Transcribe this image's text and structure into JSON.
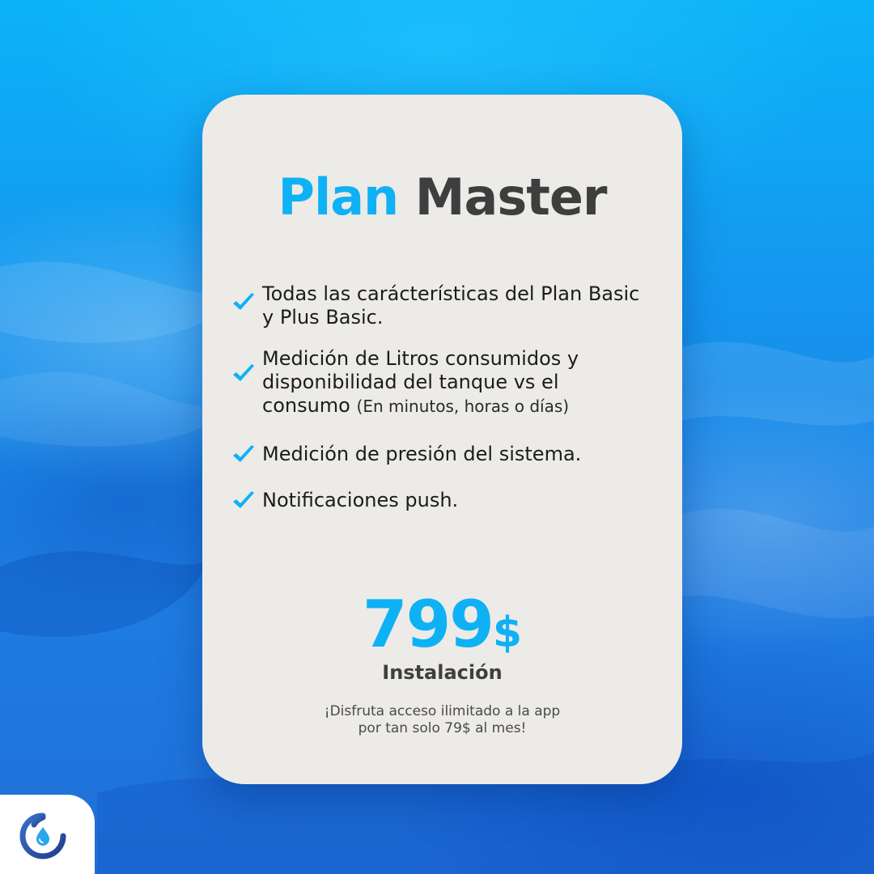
{
  "colors": {
    "accent": "#0fb1f5",
    "dark": "#3e3e3e",
    "check": "#0fb1f5"
  },
  "title": {
    "accent_word": "Plan",
    "dark_word": "Master"
  },
  "features": [
    {
      "text": "Todas las carácterísticas del Plan Basic y Plus Basic.",
      "icon": "check-icon"
    },
    {
      "text": "Medición de Litros consumidos y disponibilidad del tanque vs el consumo",
      "note": "(En minutos, horas o días)",
      "icon": "check-icon"
    },
    {
      "text": "Medición de presión del sistema.",
      "icon": "check-icon"
    },
    {
      "text": "Notificaciones push.",
      "icon": "check-icon"
    }
  ],
  "price": {
    "amount": "799",
    "currency": "$",
    "label": "Instalación"
  },
  "promo": {
    "line1": "¡Disfruta acceso ilimitado a la app",
    "line2": "por tan solo 79$ al mes!"
  },
  "logo": {
    "icon": "water-drop-logo-icon"
  }
}
